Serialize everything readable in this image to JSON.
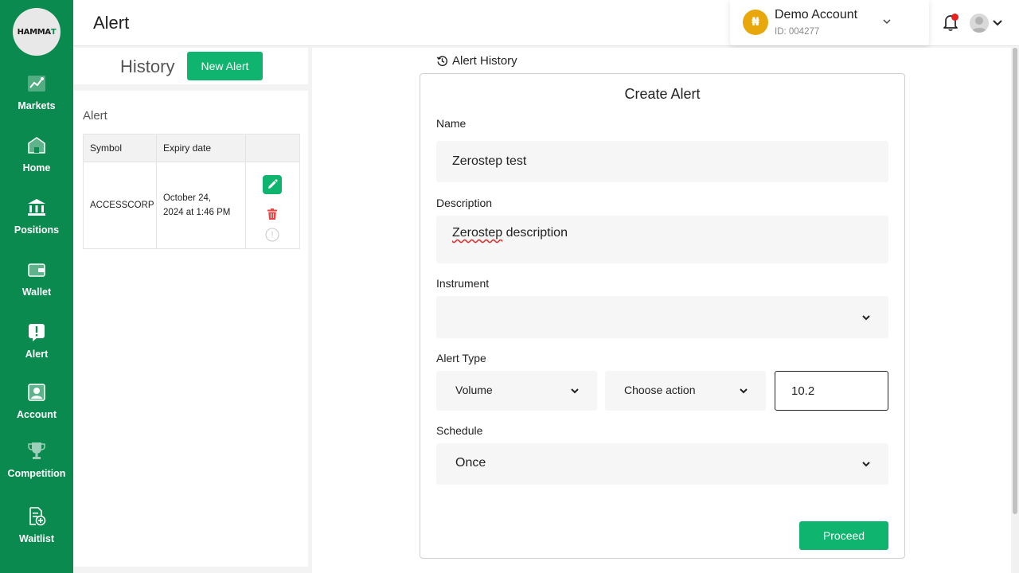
{
  "app": {
    "logo_main": "HAMMA",
    "logo_accent": "T"
  },
  "sidebar": {
    "items": [
      {
        "label": "Markets",
        "icon": "markets-chart-icon"
      },
      {
        "label": "Home",
        "icon": "home-icon"
      },
      {
        "label": "Positions",
        "icon": "bank-icon"
      },
      {
        "label": "Wallet",
        "icon": "wallet-icon"
      },
      {
        "label": "Alert",
        "icon": "alert-icon"
      },
      {
        "label": "Account",
        "icon": "account-icon"
      },
      {
        "label": "Competition",
        "icon": "trophy-icon"
      },
      {
        "label": "Waitlist",
        "icon": "waitlist-icon"
      }
    ]
  },
  "header": {
    "title": "Alert",
    "account": {
      "currency_symbol": "₦",
      "name": "Demo Account",
      "id": "ID: 004277"
    },
    "has_notification": true
  },
  "history": {
    "title": "History",
    "new_alert_label": "New Alert",
    "section_label": "Alert",
    "columns": [
      "Symbol",
      "Expiry date",
      ""
    ],
    "rows": [
      {
        "symbol": "ACCESSCORP",
        "expiry_line1": "October 24,",
        "expiry_line2": "2024 at 1:46 PM"
      }
    ]
  },
  "form": {
    "history_link": "Alert History",
    "title": "Create Alert",
    "name_label": "Name",
    "name_value": "Zerostep test",
    "description_label": "Description",
    "description_word1": "Zerostep",
    "description_rest": " description",
    "instrument_label": "Instrument",
    "instrument_value": "",
    "alert_type_label": "Alert Type",
    "alert_type_value": "Volume",
    "action_value": "Choose action",
    "threshold_value": "10.2",
    "schedule_label": "Schedule",
    "schedule_value": "Once",
    "proceed_label": "Proceed"
  },
  "colors": {
    "brand_green": "#0a8a4e",
    "button_green": "#0fb46e",
    "delete_red": "#ef4444",
    "coin_gold": "#e8a80c"
  }
}
